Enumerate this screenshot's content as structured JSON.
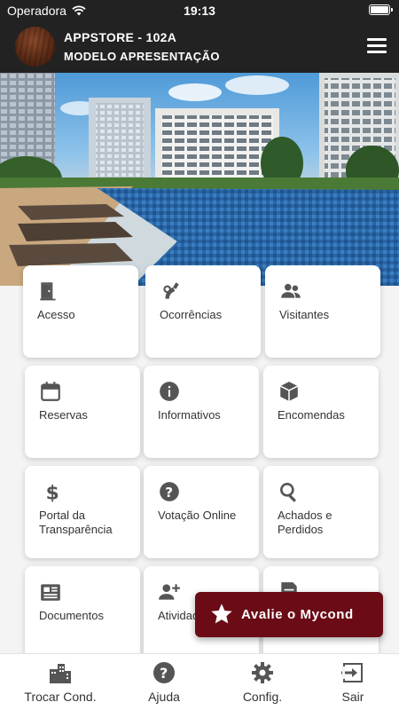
{
  "status_bar": {
    "carrier": "Operadora",
    "time": "19:13"
  },
  "header": {
    "title": "APPSTORE - 102A",
    "subtitle": "MODELO APRESENTAÇÃO"
  },
  "tiles": [
    {
      "label": "Acesso",
      "icon": "door-icon"
    },
    {
      "label": "Ocorrências",
      "icon": "megaphone-icon"
    },
    {
      "label": "Visitantes",
      "icon": "people-icon"
    },
    {
      "label": "Reservas",
      "icon": "calendar-icon"
    },
    {
      "label": "Informativos",
      "icon": "info-icon"
    },
    {
      "label": "Encomendas",
      "icon": "package-icon"
    },
    {
      "label": "Portal da Transparência",
      "icon": "dollar-icon"
    },
    {
      "label": "Votação Online",
      "icon": "question-icon"
    },
    {
      "label": "Achados e Perdidos",
      "icon": "search-icon"
    },
    {
      "label": "Documentos",
      "icon": "newspaper-icon"
    },
    {
      "label": "Atividades",
      "icon": "person-add-icon"
    },
    {
      "label": "",
      "icon": "receipt-icon"
    }
  ],
  "rate_button": {
    "label": "Avalie o Mycond",
    "color": "#6a0b16"
  },
  "bottom_nav": [
    {
      "label": "Trocar Cond.",
      "icon": "building-icon"
    },
    {
      "label": "Ajuda",
      "icon": "help-icon"
    },
    {
      "label": "Config.",
      "icon": "gear-icon"
    },
    {
      "label": "Sair",
      "icon": "logout-icon"
    }
  ],
  "colors": {
    "header_bg": "#222222",
    "icon_color": "#555555",
    "accent": "#6a0b16"
  }
}
